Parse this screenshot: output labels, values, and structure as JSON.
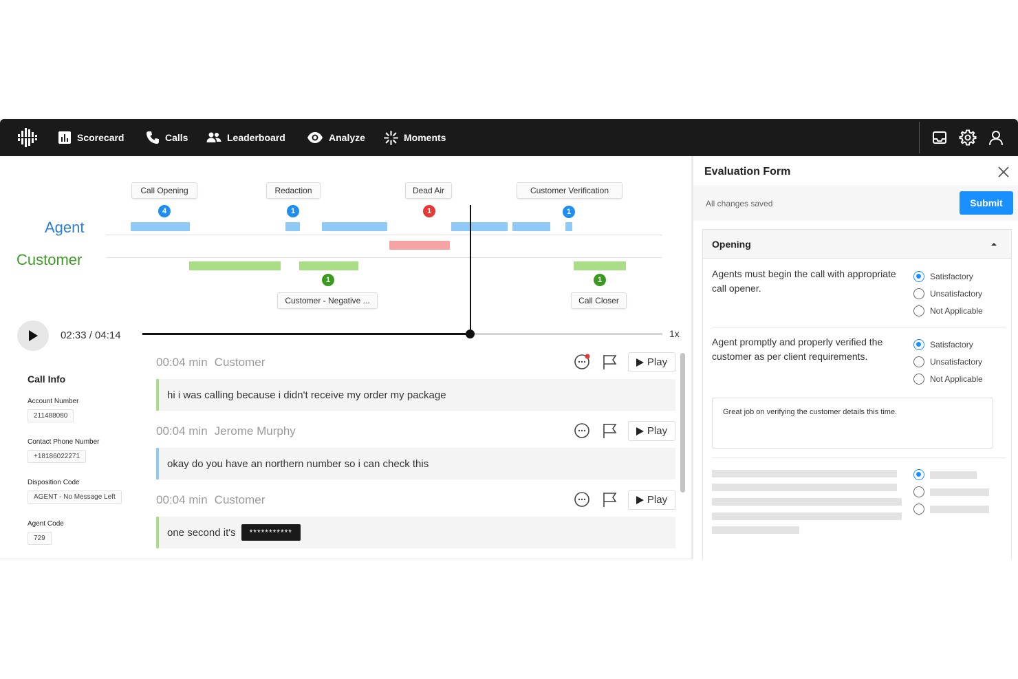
{
  "nav": {
    "items": [
      {
        "label": "Scorecard",
        "icon": "bar-chart-icon"
      },
      {
        "label": "Calls",
        "icon": "phone-icon"
      },
      {
        "label": "Leaderboard",
        "icon": "people-icon"
      },
      {
        "label": "Analyze",
        "icon": "eye-icon"
      },
      {
        "label": "Moments",
        "icon": "sparkle-icon"
      }
    ],
    "right_icons": [
      "inbox-icon",
      "gear-icon",
      "user-icon"
    ]
  },
  "timeline": {
    "speakers": {
      "agent": "Agent",
      "customer": "Customer"
    },
    "markers_top": [
      {
        "label": "Call Opening",
        "count": "4",
        "color": "#1f8ef1"
      },
      {
        "label": "Redaction",
        "count": "1",
        "color": "#1f8ef1"
      },
      {
        "label": "Dead Air",
        "count": "1",
        "color": "#e53935"
      },
      {
        "label": "Customer Verification",
        "count": "1",
        "color": "#1f8ef1"
      }
    ],
    "markers_bottom": [
      {
        "label": "Customer - Negative ...",
        "count": "1",
        "color": "#3a9a1f"
      },
      {
        "label": "Call Closer",
        "count": "1",
        "color": "#3a9a1f"
      }
    ]
  },
  "player": {
    "time": "02:33 / 04:14",
    "progress": 0.63,
    "speed": "1x"
  },
  "call_info": {
    "title": "Call Info",
    "fields": [
      {
        "label": "Account Number",
        "value": "211488080"
      },
      {
        "label": "Contact Phone Number",
        "value": "+18186022271"
      },
      {
        "label": "Disposition Code",
        "value": "AGENT - No Message Left"
      },
      {
        "label": "Agent Code",
        "value": "729"
      }
    ]
  },
  "transcript": [
    {
      "time": "00:04 min",
      "speaker": "Customer",
      "text": "hi i was calling because i didn't receive my order my package",
      "redacted": "",
      "unread": true
    },
    {
      "time": "00:04 min",
      "speaker": "Jerome Murphy",
      "text": "okay do you have an northern number so i can check this",
      "redacted": "",
      "unread": false
    },
    {
      "time": "00:04 min",
      "speaker": "Customer",
      "text": "one second it's",
      "redacted": "***********",
      "unread": false
    }
  ],
  "transcript_play_label": "Play",
  "evaluation": {
    "title": "Evaluation Form",
    "status": "All changes saved",
    "submit_label": "Submit",
    "section_title": "Opening",
    "questions": [
      {
        "text": "Agents must begin the call with appropriate call opener.",
        "options": [
          "Satisfactory",
          "Unsatisfactory",
          "Not Applicable"
        ],
        "selected": 0
      },
      {
        "text": "Agent promptly and properly verified the customer as per client requirements.",
        "options": [
          "Satisfactory",
          "Unsatisfactory",
          "Not Applicable"
        ],
        "selected": 0
      }
    ],
    "comment": "Great job on verifying the customer details this time."
  },
  "colors": {
    "nav_bg": "#1a1a1a",
    "agent": "#2b7fd6",
    "customer": "#3f9a25",
    "accent": "#1a90ff",
    "agent_segment": "#8fc9f5",
    "customer_segment": "#a9de86",
    "dead_air_segment": "#f5a3a3"
  }
}
